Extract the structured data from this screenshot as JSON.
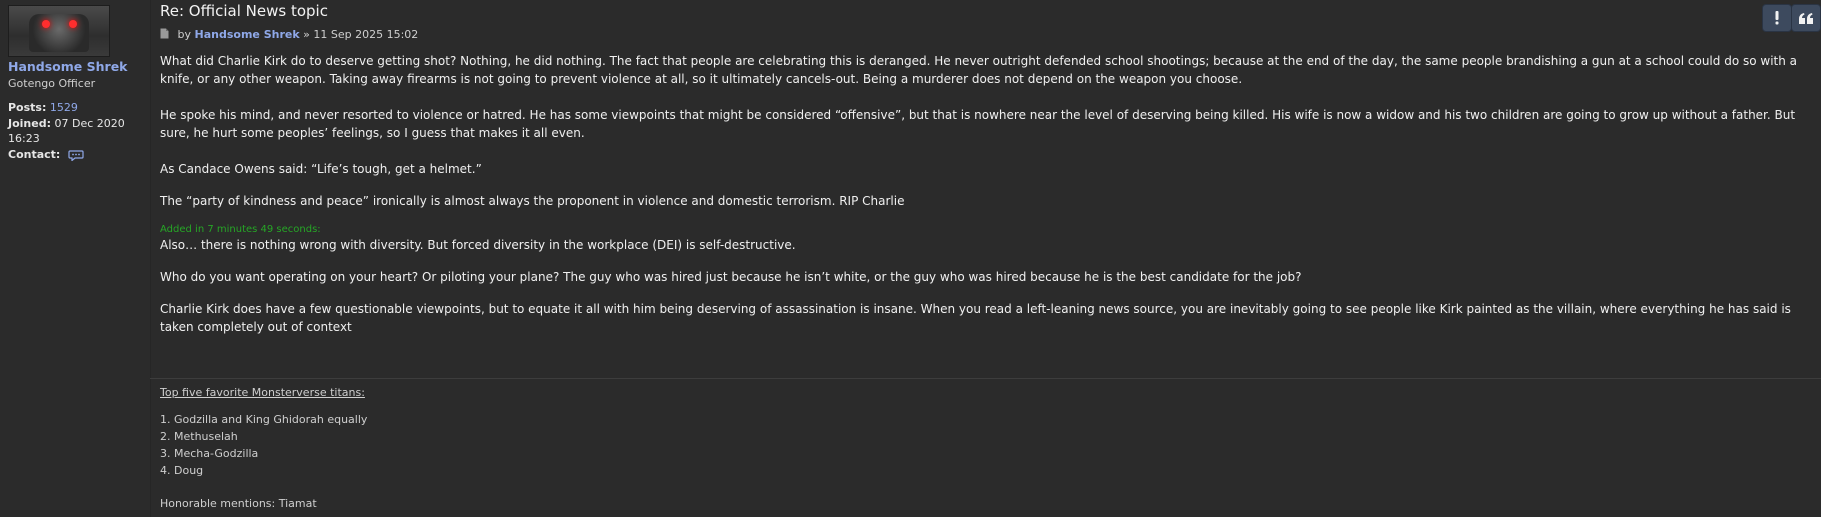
{
  "profile": {
    "username": "Handsome Shrek",
    "rank": "Gotengo Officer",
    "posts_label": "Posts:",
    "posts_value": "1529",
    "joined_label": "Joined:",
    "joined_value": "07 Dec 2020",
    "joined_time": "16:23",
    "contact_label": "Contact:"
  },
  "post": {
    "title": "Re: Official News topic",
    "by": "by",
    "author": "Handsome Shrek",
    "separator": "»",
    "date": "11 Sep 2025 15:02",
    "paragraphs": {
      "p1": "What did Charlie Kirk do to deserve getting shot? Nothing, he did nothing. The fact that people are celebrating this is deranged. He never outright defended school shootings; because at the end of the day, the same people brandishing a gun at a school could do so with a knife, or any other weapon. Taking away firearms is not going to prevent violence at all, so it ultimately cancels-out. Being a murderer does not depend on the weapon you choose.",
      "p2": "He spoke his mind, and never resorted to violence or hatred. He has some viewpoints that might be considered “offensive”, but that is nowhere near the level of deserving being killed. His wife is now a widow and his two children are going to grow up without a father. But sure, he hurt some peoples’ feelings, so I guess that makes it all even.",
      "p3": "As Candace Owens said: “Life’s tough, get a helmet.”",
      "p4": "The “party of kindness and peace” ironically is almost always the proponent in violence and domestic terrorism. RIP Charlie",
      "added": "Added in 7 minutes 49 seconds:",
      "p5": "Also… there is nothing wrong with diversity. But forced diversity in the workplace (DEI) is self-destructive.",
      "p6": "Who do you want operating on your heart? Or piloting your plane? The guy who was hired just because he isn’t white, or the guy who was hired because he is the best candidate for the job?",
      "p7": "Charlie Kirk does have a few questionable viewpoints, but to equate it all with him being deserving of assassination is insane. When you read a left-leaning news source, you are inevitably going to see people like Kirk painted as the villain, where everything he has said is taken completely out of context"
    }
  },
  "signature": {
    "title": "Top five favorite Monsterverse titans:",
    "items": [
      "1. Godzilla and King Ghidorah equally",
      "2. Methuselah",
      "3. Mecha-Godzilla",
      "4. Doug"
    ],
    "honorable": "Honorable mentions: Tiamat"
  },
  "actions": {
    "report_icon": "exclamation-icon",
    "quote_icon": "quote-icon",
    "button_color": "#3d4a5e"
  },
  "colors": {
    "background": "#2b2b2b",
    "link": "#8fa8e8",
    "added_text": "#26a626"
  }
}
